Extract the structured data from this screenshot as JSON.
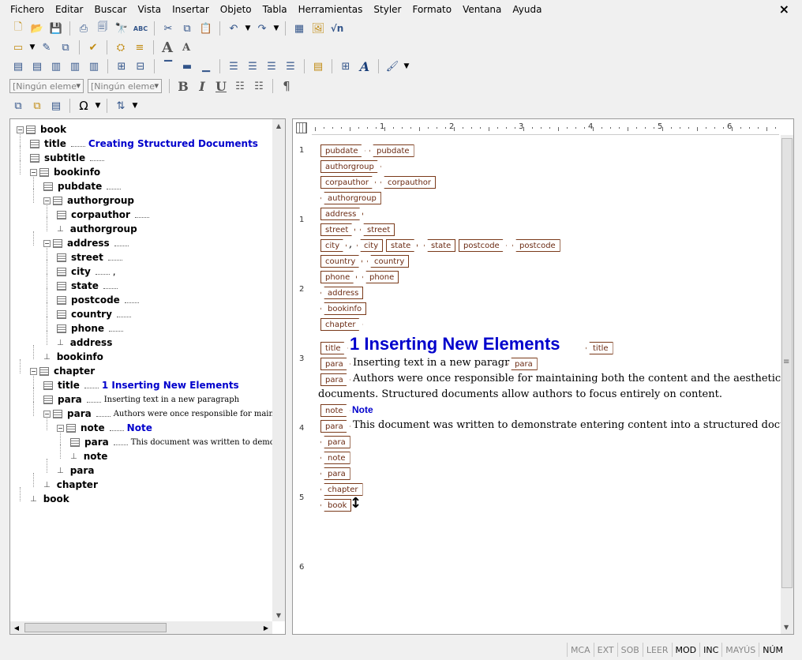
{
  "menu": [
    "Fichero",
    "Editar",
    "Buscar",
    "Vista",
    "Insertar",
    "Objeto",
    "Tabla",
    "Herramientas",
    "Styler",
    "Formato",
    "Ventana",
    "Ayuda"
  ],
  "close_glyph": "×",
  "toolbar": {
    "row1": [
      "new-document-icon",
      "open-folder-icon",
      "save-icon",
      "print-icon",
      "print-preview-icon",
      "find-icon",
      "spell-check-icon",
      "cut-icon",
      "copy-icon",
      "paste-icon",
      "undo-icon",
      "redo-icon",
      "table-icon",
      "image-icon",
      "equation-icon"
    ],
    "equation_glyph": "√n",
    "spell_glyph": "ABC",
    "style_select_1": "[Ningún eleme",
    "style_select_2": "[Ningún eleme",
    "bold": "B",
    "italic": "I",
    "underline": "U",
    "pilcrow": "¶",
    "omega": "Ω",
    "font_grow": "A",
    "font_shrink": "A",
    "font_style": "A"
  },
  "tree": [
    {
      "tag": "book",
      "level": 0,
      "type": "root"
    },
    {
      "tag": "title",
      "level": 1,
      "content": "Creating Structured Documents",
      "content_style": "blue"
    },
    {
      "tag": "subtitle",
      "level": 1,
      "content": ""
    },
    {
      "tag": "bookinfo",
      "level": 1,
      "type": "open"
    },
    {
      "tag": "pubdate",
      "level": 2,
      "content": ""
    },
    {
      "tag": "authorgroup",
      "level": 2,
      "type": "open"
    },
    {
      "tag": "corpauthor",
      "level": 3,
      "content": ""
    },
    {
      "tag": "authorgroup",
      "level": 3,
      "type": "end"
    },
    {
      "tag": "address",
      "level": 2,
      "type": "open",
      "content": ""
    },
    {
      "tag": "street",
      "level": 3,
      "content": ""
    },
    {
      "tag": "city",
      "level": 3,
      "content": ","
    },
    {
      "tag": "state",
      "level": 3,
      "content": ""
    },
    {
      "tag": "postcode",
      "level": 3,
      "content": ""
    },
    {
      "tag": "country",
      "level": 3,
      "content": ""
    },
    {
      "tag": "phone",
      "level": 3,
      "content": ""
    },
    {
      "tag": "address",
      "level": 3,
      "type": "end"
    },
    {
      "tag": "bookinfo",
      "level": 2,
      "type": "end"
    },
    {
      "tag": "chapter",
      "level": 1,
      "type": "open"
    },
    {
      "tag": "title",
      "level": 2,
      "content": "1  Inserting New Elements",
      "content_style": "blue"
    },
    {
      "tag": "para",
      "level": 2,
      "content": "Inserting text in a new paragraph",
      "content_style": "serif"
    },
    {
      "tag": "para",
      "level": 2,
      "type": "open",
      "content": "Authors were once responsible for maintaining",
      "content_style": "serif"
    },
    {
      "tag": "note",
      "level": 3,
      "type": "open",
      "content": "Note",
      "content_style": "blue"
    },
    {
      "tag": "para",
      "level": 4,
      "content": "This document was written to demonstrate",
      "content_style": "serif"
    },
    {
      "tag": "note",
      "level": 4,
      "type": "end"
    },
    {
      "tag": "para",
      "level": 3,
      "type": "end"
    },
    {
      "tag": "chapter",
      "level": 2,
      "type": "end"
    },
    {
      "tag": "book",
      "level": 1,
      "type": "end"
    }
  ],
  "ruler": {
    "h_labels": [
      "1",
      "2",
      "3",
      "4",
      "5",
      "6"
    ],
    "v_labels": [
      "1",
      "1",
      "2",
      "3",
      "4",
      "5",
      "6"
    ]
  },
  "doc": {
    "pubdate": "pubdate",
    "authorgroup": "authorgroup",
    "corpauthor": "corpauthor",
    "address": "address",
    "street": "street",
    "city": "city",
    "state": "state",
    "postcode": "postcode",
    "country": "country",
    "phone": "phone",
    "bookinfo": "bookinfo",
    "chapter": "chapter",
    "title": "title",
    "para": "para",
    "note": "note",
    "book": "book",
    "comma": ",",
    "chapter_title": "1  Inserting New Elements",
    "para1": "Inserting text in a new paragraph",
    "para2_line1": "Authors were once responsible for maintaining both the content and the aesthetic of their",
    "para2_line2": "documents. Structured documents allow authors to focus entirely on content.",
    "note_label": "Note",
    "note_para": "This document was written to demonstrate entering content into a structured document."
  },
  "status": [
    "MCA",
    "EXT",
    "SOB",
    "LEER",
    "MOD",
    "INC",
    "MAYÚS",
    "NÚM"
  ],
  "status_active": [
    "MOD",
    "INC",
    "NÚM"
  ]
}
